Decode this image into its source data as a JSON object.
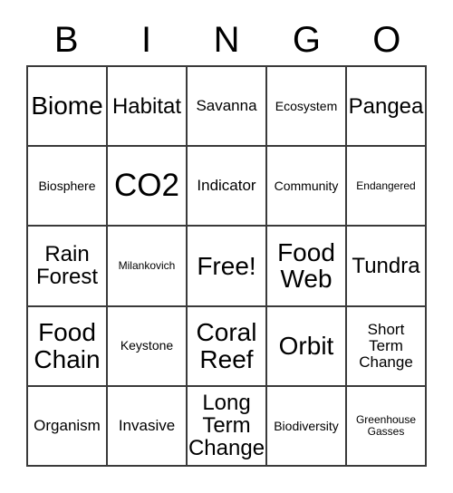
{
  "card": {
    "title": "BINGO Card",
    "headers": [
      "B",
      "I",
      "N",
      "G",
      "O"
    ],
    "rows": [
      [
        {
          "label": "Biome",
          "size": "lg"
        },
        {
          "label": "Habitat",
          "size": "md"
        },
        {
          "label": "Savanna",
          "size": "sm"
        },
        {
          "label": "Ecosystem",
          "size": "xs"
        },
        {
          "label": "Pangea",
          "size": "md"
        }
      ],
      [
        {
          "label": "Biosphere",
          "size": "xs"
        },
        {
          "label": "CO2",
          "size": "xl"
        },
        {
          "label": "Indicator",
          "size": "sm"
        },
        {
          "label": "Community",
          "size": "xs"
        },
        {
          "label": "Endangered",
          "size": "xxs"
        }
      ],
      [
        {
          "label": "Rain\nForest",
          "size": "md"
        },
        {
          "label": "Milankovich",
          "size": "xxs"
        },
        {
          "label": "Free!",
          "size": "lg"
        },
        {
          "label": "Food\nWeb",
          "size": "lg"
        },
        {
          "label": "Tundra",
          "size": "md"
        }
      ],
      [
        {
          "label": "Food\nChain",
          "size": "lg"
        },
        {
          "label": "Keystone",
          "size": "xs"
        },
        {
          "label": "Coral\nReef",
          "size": "lg"
        },
        {
          "label": "Orbit",
          "size": "lg"
        },
        {
          "label": "Short\nTerm\nChange",
          "size": "sm"
        }
      ],
      [
        {
          "label": "Organism",
          "size": "sm"
        },
        {
          "label": "Invasive",
          "size": "sm"
        },
        {
          "label": "Long\nTerm\nChange",
          "size": "md"
        },
        {
          "label": "Biodiversity",
          "size": "xs"
        },
        {
          "label": "Greenhouse\nGasses",
          "size": "xxs"
        }
      ]
    ]
  },
  "colors": {
    "background": "#ffffff",
    "grid_line": "#3a3a3a",
    "text": "#000000"
  }
}
